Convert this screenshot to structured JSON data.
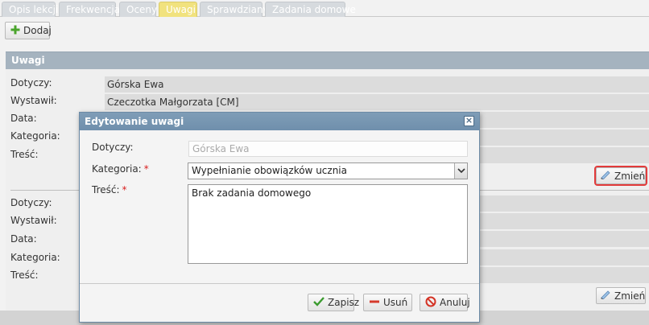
{
  "tabs": [
    {
      "label": "Opis lekcji"
    },
    {
      "label": "Frekwencja"
    },
    {
      "label": "Oceny"
    },
    {
      "label": "Uwagi"
    },
    {
      "label": "Sprawdziany"
    },
    {
      "label": "Zadania domowe"
    }
  ],
  "active_tab": "Uwagi",
  "toolbar": {
    "add_label": "Dodaj"
  },
  "panel": {
    "title": "Uwagi",
    "labels": {
      "dotyczy": "Dotyczy:",
      "wystawil": "Wystawił:",
      "data": "Data:",
      "kategoria": "Kategoria:",
      "tresc": "Treść:"
    },
    "record1": {
      "dotyczy": "Górska Ewa",
      "wystawil": "Czeczotka Małgorzata [CM]"
    },
    "change_label": "Zmień"
  },
  "modal": {
    "title": "Edytowanie uwagi",
    "labels": {
      "dotyczy": "Dotyczy:",
      "kategoria": "Kategoria:",
      "tresc": "Treść:",
      "required_mark": "*"
    },
    "dotyczy_value": "Górska Ewa",
    "kategoria_value": "Wypełnianie obowiązków ucznia",
    "tresc_value": "Brak zadania domowego",
    "buttons": {
      "save": "Zapisz",
      "delete": "Usuń",
      "cancel": "Anuluj"
    }
  },
  "colors": {
    "tab_active": "#f1e27e",
    "panel_header": "#a5b3bf",
    "modal_title": "#7393af",
    "highlight": "#e23b3b",
    "required": "#d81e1e"
  },
  "icons": {
    "add": "plus-icon",
    "change": "pencil-icon",
    "close": "close-icon",
    "dropdown": "chevron-down-icon",
    "save": "checkmark-icon",
    "delete": "minus-icon",
    "cancel": "no-entry-icon"
  }
}
